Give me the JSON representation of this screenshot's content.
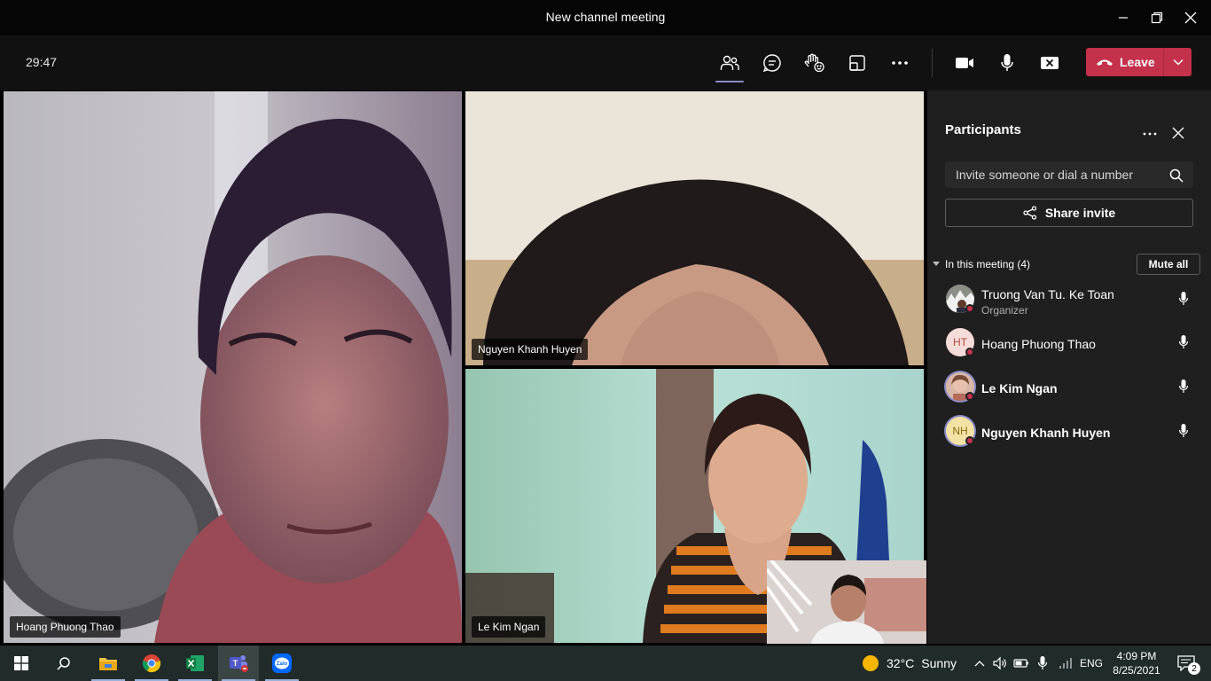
{
  "window": {
    "title": "New channel meeting"
  },
  "toolbar": {
    "timer": "29:47",
    "leave_label": "Leave",
    "buttons": [
      "participants-icon",
      "chat-icon",
      "raise-hand-icon",
      "rooms-icon",
      "more-icon",
      "camera-icon",
      "mic-icon",
      "share-tray-icon"
    ]
  },
  "videos": [
    {
      "name": "Hoang Phuong Thao"
    },
    {
      "name": "Nguyen Khanh Huyen"
    },
    {
      "name": "Le Kim Ngan"
    }
  ],
  "panel": {
    "title": "Participants",
    "search_placeholder": "Invite someone or dial a number",
    "share_label": "Share invite",
    "section_label": "In this meeting (4)",
    "mute_all_label": "Mute all",
    "participants": [
      {
        "name": "Truong Van Tu. Ke Toan",
        "role": "Organizer",
        "initials": ""
      },
      {
        "name": "Hoang Phuong Thao",
        "role": "",
        "initials": "HT"
      },
      {
        "name": "Le Kim Ngan",
        "role": "",
        "initials": ""
      },
      {
        "name": "Nguyen Khanh Huyen",
        "role": "",
        "initials": "NH"
      }
    ]
  },
  "taskbar": {
    "weather_temp": "32°C",
    "weather_text": "Sunny",
    "language": "ENG",
    "time": "4:09 PM",
    "date": "8/25/2021",
    "notifications": "2",
    "zalo_label": "Zalo"
  },
  "colors": {
    "leave": "#c4314b",
    "accent": "#8b8cc7",
    "panel_bg": "#1f1f1f",
    "taskbar_bg": "#202b2a"
  }
}
